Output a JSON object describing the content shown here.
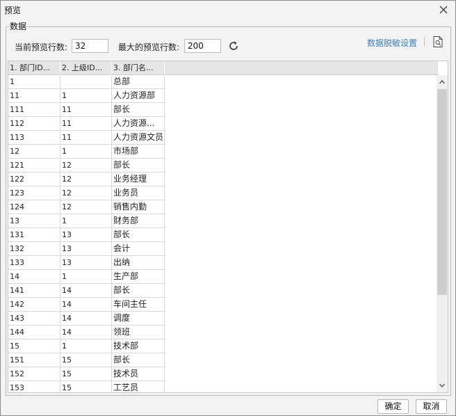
{
  "dialog": {
    "title": "预览",
    "group_label": "数据",
    "current_rows_label": "当前预览行数:",
    "current_rows_value": "32",
    "max_rows_label": "最大的预览行数:",
    "max_rows_value": "200",
    "mask_settings_label": "数据脱敏设置",
    "ok_label": "确定",
    "cancel_label": "取消"
  },
  "table": {
    "headers": [
      "1. 部门ID...",
      "2. 上级ID...",
      "3. 部门名..."
    ],
    "rows": [
      [
        "1",
        "",
        "总部"
      ],
      [
        "11",
        "1",
        "人力资源部"
      ],
      [
        "111",
        "11",
        "部长"
      ],
      [
        "112",
        "11",
        "人力资源..."
      ],
      [
        "113",
        "11",
        "人力资源文员"
      ],
      [
        "12",
        "1",
        "市场部"
      ],
      [
        "121",
        "12",
        "部长"
      ],
      [
        "122",
        "12",
        "业务经理"
      ],
      [
        "123",
        "12",
        "业务员"
      ],
      [
        "124",
        "12",
        "销售内勤"
      ],
      [
        "13",
        "1",
        "财务部"
      ],
      [
        "131",
        "13",
        "部长"
      ],
      [
        "132",
        "13",
        "会计"
      ],
      [
        "133",
        "13",
        "出纳"
      ],
      [
        "14",
        "1",
        "生产部"
      ],
      [
        "141",
        "14",
        "部长"
      ],
      [
        "142",
        "14",
        "车间主任"
      ],
      [
        "143",
        "14",
        "调度"
      ],
      [
        "144",
        "14",
        "领班"
      ],
      [
        "15",
        "1",
        "技术部"
      ],
      [
        "151",
        "15",
        "部长"
      ],
      [
        "152",
        "15",
        "技术员"
      ],
      [
        "153",
        "15",
        "工艺员"
      ]
    ]
  },
  "icons": {
    "close": "close-icon",
    "refresh": "refresh-icon",
    "preview": "document-preview-icon"
  },
  "colors": {
    "link": "#3d7fc1"
  }
}
